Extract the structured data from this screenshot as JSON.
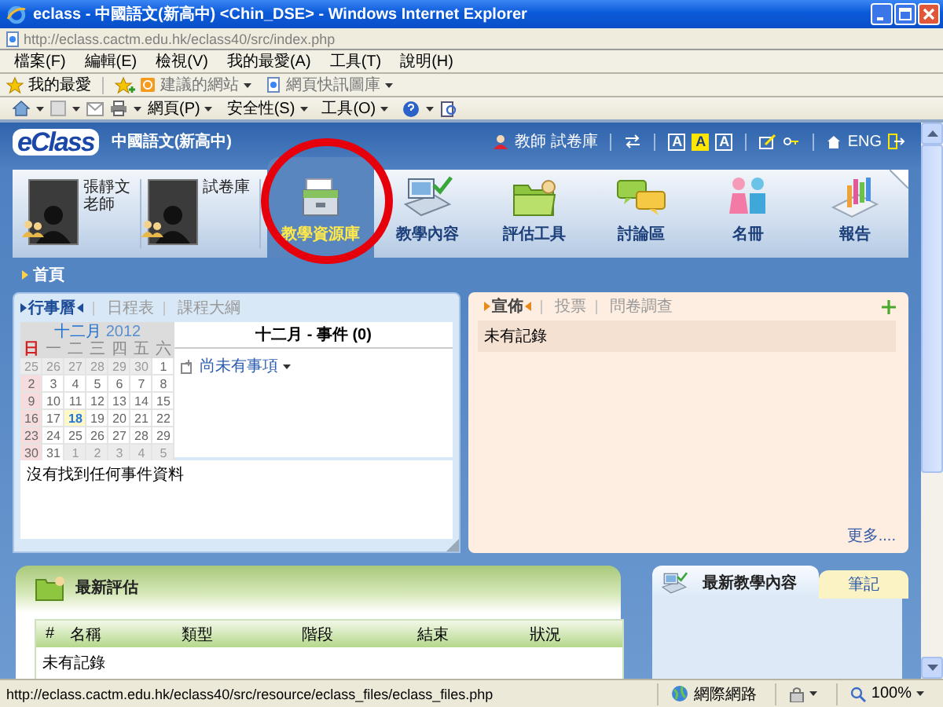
{
  "browser": {
    "title": "eclass - 中國語文(新高中) <Chin_DSE> - Windows Internet Explorer",
    "address": "http://eclass.cactm.edu.hk/eclass40/src/index.php",
    "menu": [
      "檔案(F)",
      "編輯(E)",
      "檢視(V)",
      "我的最愛(A)",
      "工具(T)",
      "說明(H)"
    ],
    "favorites_label": "我的最愛",
    "favorite_links": [
      "建議的網站",
      "網頁快訊圖庫"
    ],
    "commands": [
      "網頁(P)",
      "安全性(S)",
      "工具(O)"
    ]
  },
  "header": {
    "logo": "eClass",
    "course": "中國語文(新高中)",
    "user": "教師 試卷庫",
    "font_sizes": [
      {
        "label": "A",
        "selected": false
      },
      {
        "label": "A",
        "selected": true
      },
      {
        "label": "A",
        "selected": false
      }
    ],
    "language": "ENG"
  },
  "nav": {
    "people": [
      {
        "name": "張靜文老師"
      },
      {
        "name": "試卷庫"
      }
    ],
    "modules": [
      {
        "label": "教學資源庫",
        "selected": true
      },
      {
        "label": "教學內容",
        "selected": false
      },
      {
        "label": "評估工具",
        "selected": false
      },
      {
        "label": "討論區",
        "selected": false
      },
      {
        "label": "名冊",
        "selected": false
      },
      {
        "label": "報告",
        "selected": false
      }
    ]
  },
  "breadcrumb": "首頁",
  "calendar_panel": {
    "tabs": [
      {
        "label": "行事曆",
        "selected": true
      },
      {
        "label": "日程表",
        "selected": false
      },
      {
        "label": "課程大綱",
        "selected": false
      }
    ],
    "month": "十二月",
    "year": "2012",
    "weekdays": [
      "日",
      "一",
      "二",
      "三",
      "四",
      "五",
      "六"
    ],
    "weeks": [
      [
        {
          "d": "25",
          "outside": true,
          "today": false
        },
        {
          "d": "26",
          "outside": true,
          "today": false
        },
        {
          "d": "27",
          "outside": true,
          "today": false
        },
        {
          "d": "28",
          "outside": true,
          "today": false
        },
        {
          "d": "29",
          "outside": true,
          "today": false
        },
        {
          "d": "30",
          "outside": true,
          "today": false
        },
        {
          "d": "1",
          "outside": false,
          "today": false
        }
      ],
      [
        {
          "d": "2",
          "outside": false,
          "today": false
        },
        {
          "d": "3",
          "outside": false,
          "today": false
        },
        {
          "d": "4",
          "outside": false,
          "today": false
        },
        {
          "d": "5",
          "outside": false,
          "today": false
        },
        {
          "d": "6",
          "outside": false,
          "today": false
        },
        {
          "d": "7",
          "outside": false,
          "today": false
        },
        {
          "d": "8",
          "outside": false,
          "today": false
        }
      ],
      [
        {
          "d": "9",
          "outside": false,
          "today": false
        },
        {
          "d": "10",
          "outside": false,
          "today": false
        },
        {
          "d": "11",
          "outside": false,
          "today": false
        },
        {
          "d": "12",
          "outside": false,
          "today": false
        },
        {
          "d": "13",
          "outside": false,
          "today": false
        },
        {
          "d": "14",
          "outside": false,
          "today": false
        },
        {
          "d": "15",
          "outside": false,
          "today": false
        }
      ],
      [
        {
          "d": "16",
          "outside": false,
          "today": false
        },
        {
          "d": "17",
          "outside": false,
          "today": false
        },
        {
          "d": "18",
          "outside": false,
          "today": true
        },
        {
          "d": "19",
          "outside": false,
          "today": false
        },
        {
          "d": "20",
          "outside": false,
          "today": false
        },
        {
          "d": "21",
          "outside": false,
          "today": false
        },
        {
          "d": "22",
          "outside": false,
          "today": false
        }
      ],
      [
        {
          "d": "23",
          "outside": false,
          "today": false
        },
        {
          "d": "24",
          "outside": false,
          "today": false
        },
        {
          "d": "25",
          "outside": false,
          "today": false
        },
        {
          "d": "26",
          "outside": false,
          "today": false
        },
        {
          "d": "27",
          "outside": false,
          "today": false
        },
        {
          "d": "28",
          "outside": false,
          "today": false
        },
        {
          "d": "29",
          "outside": false,
          "today": false
        }
      ],
      [
        {
          "d": "30",
          "outside": false,
          "today": false
        },
        {
          "d": "31",
          "outside": false,
          "today": false
        },
        {
          "d": "1",
          "outside": true,
          "today": false
        },
        {
          "d": "2",
          "outside": true,
          "today": false
        },
        {
          "d": "3",
          "outside": true,
          "today": false
        },
        {
          "d": "4",
          "outside": true,
          "today": false
        },
        {
          "d": "5",
          "outside": true,
          "today": false
        }
      ]
    ],
    "events_title": "十二月 - 事件 (0)",
    "add_link": "尚未有事項",
    "message": "沒有找到任何事件資料"
  },
  "notice_panel": {
    "tabs": [
      {
        "label": "宣佈",
        "selected": true
      },
      {
        "label": "投票",
        "selected": false
      },
      {
        "label": "問卷調查",
        "selected": false
      }
    ],
    "rows": [
      "未有記錄"
    ],
    "more": "更多...."
  },
  "assessment": {
    "title": "最新評估",
    "columns": [
      "#",
      "名稱",
      "類型",
      "階段",
      "結束",
      "狀況"
    ],
    "empty": "未有記錄"
  },
  "content_panel": {
    "tabs": [
      {
        "label": "最新教學內容",
        "selected": true
      },
      {
        "label": "筆記",
        "selected": false
      }
    ]
  },
  "status_bar": {
    "url": "http://eclass.cactm.edu.hk/eclass40/src/resource/eclass_files/eclass_files.php",
    "zone": "網際網路",
    "zoom": "100%"
  }
}
